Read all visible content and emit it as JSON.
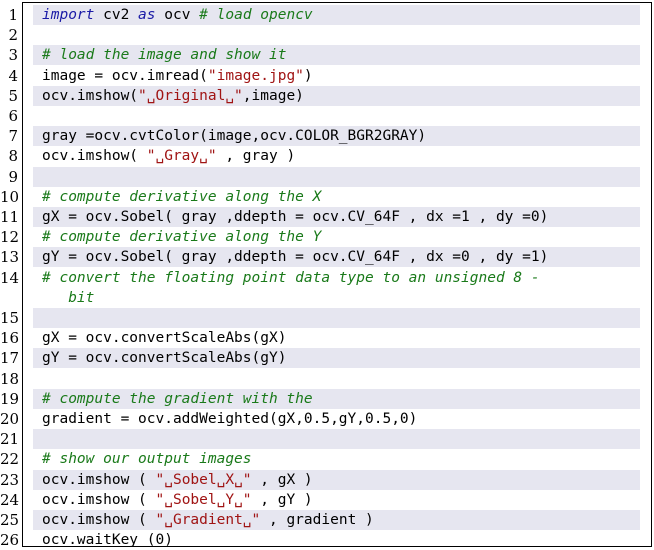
{
  "lines": [
    {
      "n": "1",
      "shaded": true,
      "parts": [
        {
          "t": "import",
          "c": "kw"
        },
        {
          "t": " cv2 ",
          "c": ""
        },
        {
          "t": "as",
          "c": "kw"
        },
        {
          "t": " ocv ",
          "c": ""
        },
        {
          "t": "# load opencv",
          "c": "cm"
        }
      ]
    },
    {
      "n": "2",
      "shaded": false,
      "parts": []
    },
    {
      "n": "3",
      "shaded": true,
      "parts": [
        {
          "t": "# load the image and show it",
          "c": "cm"
        }
      ]
    },
    {
      "n": "4",
      "shaded": false,
      "parts": [
        {
          "t": "image = ocv.imread(",
          "c": ""
        },
        {
          "t": "\"image.jpg\"",
          "c": "st"
        },
        {
          "t": ")",
          "c": ""
        }
      ]
    },
    {
      "n": "5",
      "shaded": true,
      "parts": [
        {
          "t": "ocv.imshow(",
          "c": ""
        },
        {
          "t": "\"␣Original␣\"",
          "c": "st"
        },
        {
          "t": ",image)",
          "c": ""
        }
      ]
    },
    {
      "n": "6",
      "shaded": false,
      "parts": []
    },
    {
      "n": "7",
      "shaded": true,
      "parts": [
        {
          "t": "gray =ocv.cvtColor(image,ocv.COLOR_BGR2GRAY)",
          "c": ""
        }
      ]
    },
    {
      "n": "8",
      "shaded": false,
      "parts": [
        {
          "t": "ocv.imshow( ",
          "c": ""
        },
        {
          "t": "\"␣Gray␣\"",
          "c": "st"
        },
        {
          "t": " , gray )",
          "c": ""
        }
      ]
    },
    {
      "n": "9",
      "shaded": true,
      "parts": []
    },
    {
      "n": "10",
      "shaded": false,
      "parts": [
        {
          "t": "# compute derivative along the X",
          "c": "cm"
        }
      ]
    },
    {
      "n": "11",
      "shaded": true,
      "parts": [
        {
          "t": "gX = ocv.Sobel( gray ,ddepth = ocv.CV_64F , dx =1 , dy =0)",
          "c": ""
        }
      ]
    },
    {
      "n": "12",
      "shaded": false,
      "parts": [
        {
          "t": "# compute derivative along the Y",
          "c": "cm"
        }
      ]
    },
    {
      "n": "13",
      "shaded": true,
      "parts": [
        {
          "t": "gY = ocv.Sobel( gray ,ddepth = ocv.CV_64F , dx =0 , dy =1)",
          "c": ""
        }
      ]
    },
    {
      "n": "14",
      "shaded": false,
      "parts": [
        {
          "t": "# convert the floating point data type to an unsigned 8 -",
          "c": "cm"
        }
      ]
    },
    {
      "n": "",
      "shaded": false,
      "parts": [
        {
          "t": "   bit",
          "c": "cm"
        }
      ]
    },
    {
      "n": "15",
      "shaded": true,
      "parts": []
    },
    {
      "n": "16",
      "shaded": false,
      "parts": [
        {
          "t": "gX = ocv.convertScaleAbs(gX)",
          "c": ""
        }
      ]
    },
    {
      "n": "17",
      "shaded": true,
      "parts": [
        {
          "t": "gY = ocv.convertScaleAbs(gY)",
          "c": ""
        }
      ]
    },
    {
      "n": "18",
      "shaded": false,
      "parts": []
    },
    {
      "n": "19",
      "shaded": true,
      "parts": [
        {
          "t": "# compute the gradient with the",
          "c": "cm"
        }
      ]
    },
    {
      "n": "20",
      "shaded": false,
      "parts": [
        {
          "t": "gradient = ocv.addWeighted(gX,0.5,gY,0.5,0)",
          "c": ""
        }
      ]
    },
    {
      "n": "21",
      "shaded": true,
      "parts": []
    },
    {
      "n": "22",
      "shaded": false,
      "parts": [
        {
          "t": "# show our output images",
          "c": "cm"
        }
      ]
    },
    {
      "n": "23",
      "shaded": true,
      "parts": [
        {
          "t": "ocv.imshow ( ",
          "c": ""
        },
        {
          "t": "\"␣Sobel␣X␣\"",
          "c": "st"
        },
        {
          "t": " , gX )",
          "c": ""
        }
      ]
    },
    {
      "n": "24",
      "shaded": false,
      "parts": [
        {
          "t": "ocv.imshow ( ",
          "c": ""
        },
        {
          "t": "\"␣Sobel␣Y␣\"",
          "c": "st"
        },
        {
          "t": " , gY )",
          "c": ""
        }
      ]
    },
    {
      "n": "25",
      "shaded": true,
      "parts": [
        {
          "t": "ocv.imshow ( ",
          "c": ""
        },
        {
          "t": "\"␣Gradient␣\"",
          "c": "st"
        },
        {
          "t": " , gradient )",
          "c": ""
        }
      ]
    },
    {
      "n": "26",
      "shaded": false,
      "parts": [
        {
          "t": "ocv.waitKey (0)",
          "c": ""
        }
      ]
    }
  ]
}
